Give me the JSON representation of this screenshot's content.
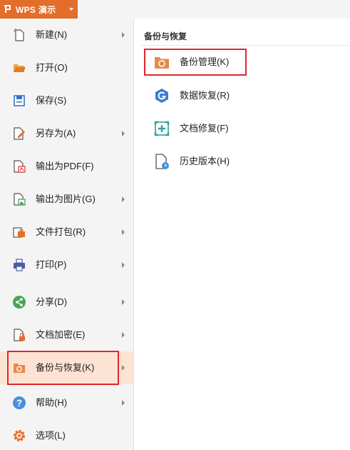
{
  "app": {
    "title": "WPS 演示"
  },
  "menu": {
    "items": [
      {
        "label": "新建(N)",
        "icon": "new-file-icon",
        "submenu": true
      },
      {
        "label": "打开(O)",
        "icon": "open-folder-icon",
        "submenu": false
      },
      {
        "label": "保存(S)",
        "icon": "save-icon",
        "submenu": false
      },
      {
        "label": "另存为(A)",
        "icon": "save-as-icon",
        "submenu": true
      },
      {
        "label": "输出为PDF(F)",
        "icon": "export-pdf-icon",
        "submenu": false
      },
      {
        "label": "输出为图片(G)",
        "icon": "export-image-icon",
        "submenu": true
      },
      {
        "label": "文件打包(R)",
        "icon": "package-icon",
        "submenu": true
      },
      {
        "label": "打印(P)",
        "icon": "print-icon",
        "submenu": true
      },
      {
        "label": "分享(D)",
        "icon": "share-icon",
        "submenu": true
      },
      {
        "label": "文档加密(E)",
        "icon": "encrypt-icon",
        "submenu": true
      },
      {
        "label": "备份与恢复(K)",
        "icon": "backup-restore-icon",
        "submenu": true,
        "active": true
      },
      {
        "label": "帮助(H)",
        "icon": "help-icon",
        "submenu": true
      },
      {
        "label": "选项(L)",
        "icon": "options-gear-icon",
        "submenu": false
      }
    ]
  },
  "panel": {
    "title": "备份与恢复",
    "items": [
      {
        "label": "备份管理(K)",
        "icon": "backup-manage-icon"
      },
      {
        "label": "数据恢复(R)",
        "icon": "data-recovery-icon"
      },
      {
        "label": "文档修复(F)",
        "icon": "doc-repair-icon"
      },
      {
        "label": "历史版本(H)",
        "icon": "history-version-icon"
      }
    ]
  },
  "colors": {
    "brand": "#e36d2a",
    "highlight": "#e0272d",
    "active_bg": "#fde3d3"
  }
}
